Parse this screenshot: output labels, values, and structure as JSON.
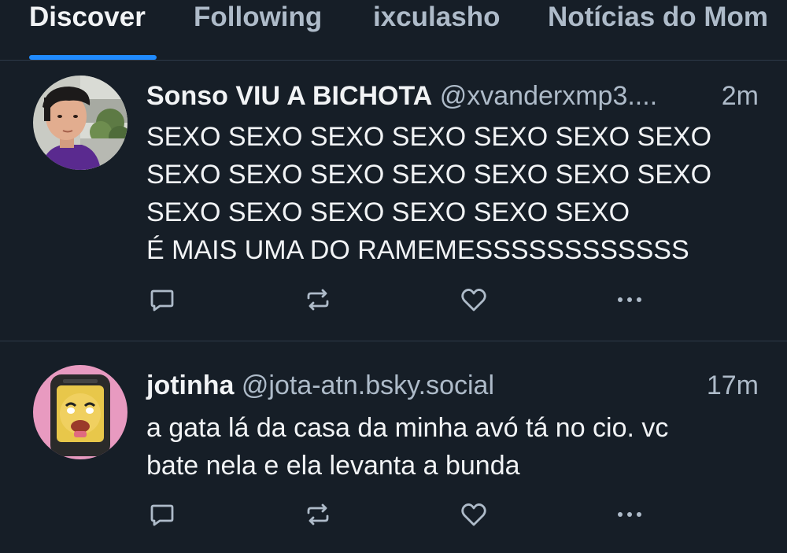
{
  "tabs": [
    {
      "label": "Discover",
      "active": true
    },
    {
      "label": "Following",
      "active": false
    },
    {
      "label": "ixculasho",
      "active": false
    },
    {
      "label": "Notícias do Mom",
      "active": false
    }
  ],
  "posts": [
    {
      "name": "Sonso VIU A BICHOTA",
      "handle": "@xvanderxmp3....",
      "time": "2m",
      "text": "SEXO SEXO SEXO SEXO SEXO SEXO SEXO\nSEXO SEXO SEXO SEXO SEXO SEXO SEXO\nSEXO SEXO SEXO SEXO SEXO SEXO\nÉ MAIS UMA DO RAMEMESSSSSSSSSSSS"
    },
    {
      "name": "jotinha",
      "handle": "@jota-atn.bsky.social",
      "time": "17m",
      "text": "a gata lá da casa da minha avó tá no cio. vc\nbate nela e ela levanta a bunda"
    }
  ],
  "icons": {
    "reply": "speech-bubble",
    "repost": "repost-arrows",
    "like": "heart",
    "more": "ellipsis"
  },
  "colors": {
    "background": "#161e27",
    "accent": "#208bfe",
    "muted_text": "#aebbc9",
    "divider": "#2e3a48"
  }
}
